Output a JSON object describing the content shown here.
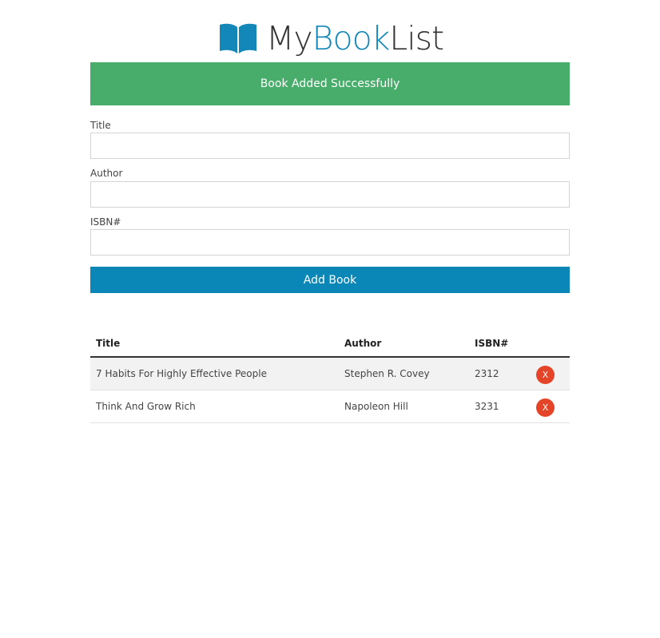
{
  "brand": {
    "icon": "open-book-icon",
    "name_part1": "My",
    "name_part2": "Book",
    "name_part3": "List",
    "accent_color": "#1287b8"
  },
  "alert": {
    "message": "Book Added Successfully",
    "color": "#48ad6b"
  },
  "form": {
    "title_label": "Title",
    "title_value": "",
    "author_label": "Author",
    "author_value": "",
    "isbn_label": "ISBN#",
    "isbn_value": "",
    "submit_label": "Add Book",
    "submit_color": "#0a87b7"
  },
  "table": {
    "columns": [
      "Title",
      "Author",
      "ISBN#",
      ""
    ],
    "rows": [
      {
        "title": "7 Habits For Highly Effective People",
        "author": "Stephen R. Covey",
        "isbn": "2312",
        "delete_label": "X"
      },
      {
        "title": "Think And Grow Rich",
        "author": "Napoleon Hill",
        "isbn": "3231",
        "delete_label": "X"
      }
    ],
    "delete_color": "#e44427"
  }
}
